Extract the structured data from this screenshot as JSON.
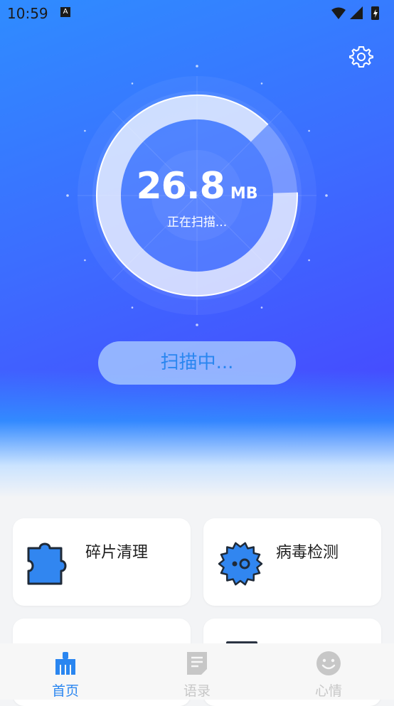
{
  "status": {
    "time": "10:59",
    "badge": "A"
  },
  "scan": {
    "value": "26.8",
    "unit": "MB",
    "status": "正在扫描...",
    "button_label": "扫描中...",
    "progress": 0.12
  },
  "features": [
    {
      "label": "碎片清理",
      "icon": "puzzle-icon"
    },
    {
      "label": "病毒检测",
      "icon": "virus-icon"
    }
  ],
  "tabs": [
    {
      "label": "首页",
      "icon": "broom-icon",
      "active": true
    },
    {
      "label": "语录",
      "icon": "document-icon",
      "active": false
    },
    {
      "label": "心情",
      "icon": "smiley-icon",
      "active": false
    }
  ],
  "colors": {
    "accent": "#2a86f0",
    "inactive": "#c7c7c7",
    "icon_blue": "#3186f0"
  }
}
